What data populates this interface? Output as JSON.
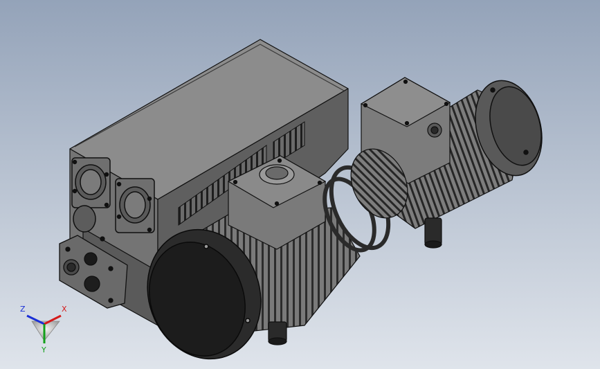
{
  "viewport": {
    "background_top": "#94a3b9",
    "background_bottom": "#dfe4eb"
  },
  "axis_triad": {
    "z_label": "Z",
    "x_label": "X",
    "y_label": "Y",
    "colors": {
      "z": "#1a2fd6",
      "x": "#d41a1a",
      "y": "#12a01a"
    }
  },
  "model": {
    "body_color": "#6e6e6e",
    "dark_color": "#1f1f1f",
    "edge_color": "#101010"
  }
}
